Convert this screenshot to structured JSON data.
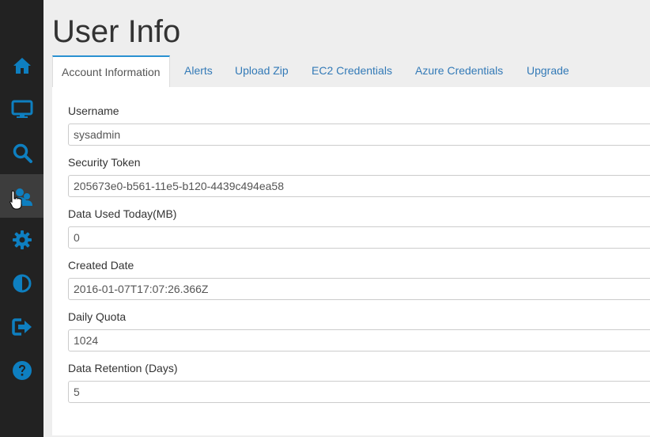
{
  "page": {
    "title": "User Info"
  },
  "sidebar": {
    "icon_color": "#0e7fc0",
    "items": [
      {
        "icon": "home-icon"
      },
      {
        "icon": "monitor-icon"
      },
      {
        "icon": "search-icon"
      },
      {
        "icon": "users-icon",
        "active": true
      },
      {
        "icon": "gear-icon"
      },
      {
        "icon": "contrast-icon"
      },
      {
        "icon": "sign-out-icon"
      },
      {
        "icon": "help-icon"
      }
    ]
  },
  "tabs": [
    {
      "label": "Account Information",
      "active": true
    },
    {
      "label": "Alerts"
    },
    {
      "label": "Upload Zip"
    },
    {
      "label": "EC2 Credentials"
    },
    {
      "label": "Azure Credentials"
    },
    {
      "label": "Upgrade"
    }
  ],
  "form": {
    "fields": [
      {
        "label": "Username",
        "value": "sysadmin"
      },
      {
        "label": "Security Token",
        "value": "205673e0-b561-11e5-b120-4439c494ea58"
      },
      {
        "label": "Data Used Today(MB)",
        "value": "0"
      },
      {
        "label": "Created Date",
        "value": "2016-01-07T17:07:26.366Z"
      },
      {
        "label": "Daily Quota",
        "value": "1024"
      },
      {
        "label": "Data Retention (Days)",
        "value": "5"
      }
    ]
  }
}
